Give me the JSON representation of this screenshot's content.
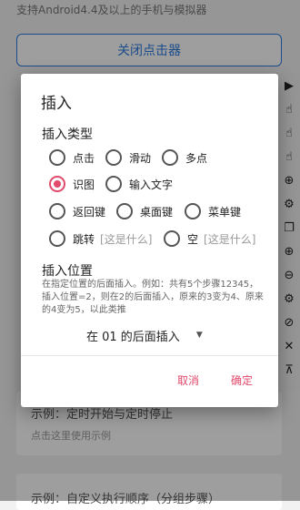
{
  "background": {
    "top_text": "支持Android4.4及以上的手机与模拟器",
    "close_button": "关闭点击器",
    "card1_title": "示例：定时开始与定时停止",
    "card1_sub": "点击这里使用示例",
    "card2_title": "示例：自定义执行顺序（分组步骤）"
  },
  "toolbar_icons": [
    "play-icon",
    "tap-icon",
    "swipe-icon",
    "multi-tap-icon",
    "zoom-icon",
    "gear-icon",
    "copy-icon",
    "add-icon",
    "remove-icon",
    "settings-icon",
    "save-icon",
    "close-icon",
    "collapse-icon"
  ],
  "dialog": {
    "title": "插入",
    "type_section": "插入类型",
    "options": {
      "click": "点击",
      "swipe": "滑动",
      "multi": "多点",
      "recognize": "识图",
      "input_text": "输入文字",
      "back": "返回键",
      "home": "桌面键",
      "menu": "菜单键",
      "jump": "跳转",
      "jump_hint": "[这是什么]",
      "empty": "空",
      "empty_hint": "[这是什么]"
    },
    "selected": "recognize",
    "position_section": "插入位置",
    "position_desc": "在指定位置的后面插入。例如：共有5个步骤12345，插入位置=2，则在2的后面插入，原来的3变为4、原来的4变为5，以此类推",
    "position_value": "在 01 的后面插入",
    "cancel": "取消",
    "confirm": "确定"
  },
  "colors": {
    "accent": "#e14a6b",
    "primary": "#2d7be0"
  }
}
